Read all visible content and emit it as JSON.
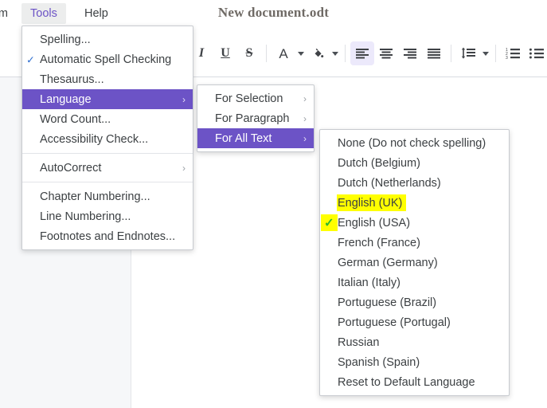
{
  "window": {
    "document_title": "New document.odt"
  },
  "menubar": {
    "items": [
      {
        "label": "rm",
        "name": "menu-form-clipped",
        "state": "clipped"
      },
      {
        "label": "Tools",
        "name": "menu-tools",
        "state": "active"
      },
      {
        "label": "Help",
        "name": "menu-help",
        "state": "normal"
      }
    ]
  },
  "toolbar": {
    "buttons": [
      {
        "label": "Italic",
        "icon": "italic-icon",
        "active": false
      },
      {
        "label": "Underline",
        "icon": "underline-icon",
        "active": false
      },
      {
        "label": "Strikethrough",
        "icon": "strikethrough-icon",
        "active": false
      },
      {
        "label": "Font Color",
        "icon": "font-color-icon",
        "active": false
      },
      {
        "label": "Highlighting Color",
        "icon": "highlight-color-icon",
        "active": false
      },
      {
        "label": "Align Left",
        "icon": "align-left-icon",
        "active": true
      },
      {
        "label": "Align Center",
        "icon": "align-center-icon",
        "active": false
      },
      {
        "label": "Align Right",
        "icon": "align-right-icon",
        "active": false
      },
      {
        "label": "Justified",
        "icon": "align-justify-icon",
        "active": false
      },
      {
        "label": "Line Spacing",
        "icon": "line-spacing-icon",
        "active": false
      },
      {
        "label": "Ordered List",
        "icon": "ordered-list-icon",
        "active": false
      },
      {
        "label": "Unordered List",
        "icon": "unordered-list-icon",
        "active": false
      }
    ]
  },
  "menus": {
    "tools": {
      "items": [
        {
          "label": "Spelling...",
          "checked": false,
          "submenu": false,
          "selected": false
        },
        {
          "label": "Automatic Spell Checking",
          "checked": true,
          "submenu": false,
          "selected": false
        },
        {
          "label": "Thesaurus...",
          "checked": false,
          "submenu": false,
          "selected": false
        },
        {
          "label": "Language",
          "checked": false,
          "submenu": true,
          "selected": true
        },
        {
          "label": "Word Count...",
          "checked": false,
          "submenu": false,
          "selected": false
        },
        {
          "label": "Accessibility Check...",
          "checked": false,
          "submenu": false,
          "selected": false
        },
        {
          "label": "AutoCorrect",
          "checked": false,
          "submenu": true,
          "selected": false
        },
        {
          "label": "Chapter Numbering...",
          "checked": false,
          "submenu": false,
          "selected": false
        },
        {
          "label": "Line Numbering...",
          "checked": false,
          "submenu": false,
          "selected": false
        },
        {
          "label": "Footnotes and Endnotes...",
          "checked": false,
          "submenu": false,
          "selected": false
        }
      ]
    },
    "language": {
      "items": [
        {
          "label": "For Selection",
          "submenu": true,
          "selected": false
        },
        {
          "label": "For Paragraph",
          "submenu": true,
          "selected": false
        },
        {
          "label": "For All Text",
          "submenu": true,
          "selected": true
        }
      ]
    },
    "languages": {
      "items": [
        {
          "label": "None (Do not check spelling)",
          "checked": false,
          "highlighted": false
        },
        {
          "label": "Dutch (Belgium)",
          "checked": false,
          "highlighted": false
        },
        {
          "label": "Dutch (Netherlands)",
          "checked": false,
          "highlighted": false
        },
        {
          "label": "English (UK)",
          "checked": false,
          "highlighted": true
        },
        {
          "label": "English (USA)",
          "checked": true,
          "highlighted": false
        },
        {
          "label": "French (France)",
          "checked": false,
          "highlighted": false
        },
        {
          "label": "German (Germany)",
          "checked": false,
          "highlighted": false
        },
        {
          "label": "Italian (Italy)",
          "checked": false,
          "highlighted": false
        },
        {
          "label": "Portuguese (Brazil)",
          "checked": false,
          "highlighted": false
        },
        {
          "label": "Portuguese (Portugal)",
          "checked": false,
          "highlighted": false
        },
        {
          "label": "Russian",
          "checked": false,
          "highlighted": false
        },
        {
          "label": "Spanish (Spain)",
          "checked": false,
          "highlighted": false
        },
        {
          "label": "Reset to Default Language",
          "checked": false,
          "highlighted": false
        }
      ]
    }
  },
  "colors": {
    "accent_purple": "#6c53c6",
    "highlight_yellow": "#ffff00",
    "check_blue": "#2f6fd0",
    "check_green": "#2eb82e",
    "page_gutter": "#f6f7f9",
    "title_text": "#6f6a65"
  },
  "glyphs": {
    "italic": "I",
    "underline": "U",
    "strikethrough": "S",
    "font_color_letter": "A",
    "submenu_arrow": "›",
    "check": "✓"
  }
}
